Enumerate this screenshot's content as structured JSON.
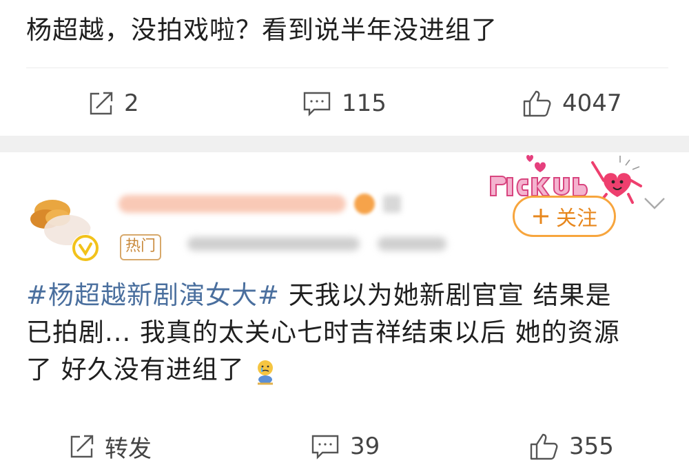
{
  "post1": {
    "text": "杨超越，没拍戏啦？看到说半年没进组了",
    "actions": {
      "repost": {
        "icon": "share-icon",
        "count": "2"
      },
      "comment": {
        "icon": "comment-icon",
        "count": "115"
      },
      "like": {
        "icon": "thumbs-up-icon",
        "count": "4047"
      }
    }
  },
  "post2": {
    "author": {
      "badge": "热门",
      "follow_label": "关注",
      "follow_icon": "plus-icon",
      "decoration_icon": "pick-me-heart-sticker-icon"
    },
    "hashtag": "#杨超越新剧演女大#",
    "line1_rest": " 天我以为她新剧官宣  结果是",
    "line2": "已拍剧... 我真的太关心七时吉祥结束以后 她的资源",
    "line3": "了  好久没有进组了",
    "emoji": "crying-emoji-icon",
    "actions": {
      "repost": {
        "icon": "share-icon",
        "label": "转发"
      },
      "comment": {
        "icon": "comment-icon",
        "count": "39"
      },
      "like": {
        "icon": "thumbs-up-icon",
        "count": "355"
      }
    }
  },
  "colors": {
    "hashtag": "#4a6f9e",
    "follow_accent": "#f7a53d",
    "separator": "#f0f0f0"
  }
}
